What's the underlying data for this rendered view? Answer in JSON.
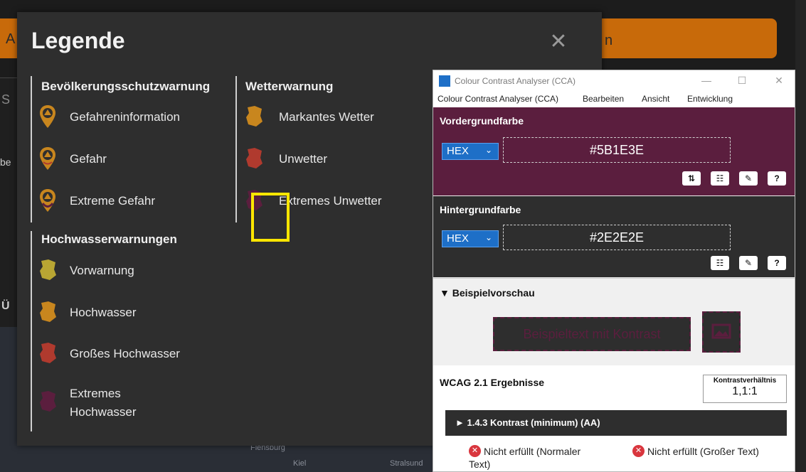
{
  "background_app": {
    "button_right_fragment": "n",
    "button_left_fragment": "A",
    "fragment_s": "S",
    "fragment_be": "be",
    "fragment_u": "Ü",
    "map_cities": [
      "Flensburg",
      "Kiel",
      "Stralsund"
    ]
  },
  "legend": {
    "title": "Legende",
    "close_icon": "close-icon",
    "columns": [
      {
        "groups": [
          {
            "heading": "Bevölkerungsschutzwarnung",
            "items": [
              {
                "label": "Gefahreninformation",
                "icon": "pin-info-icon",
                "color": "#c8861e"
              },
              {
                "label": "Gefahr",
                "icon": "pin-danger-icon",
                "color": "#c8861e"
              },
              {
                "label": "Extreme Gefahr",
                "icon": "pin-extreme-icon",
                "color": "#c8861e"
              }
            ]
          },
          {
            "heading": "Hochwasserwarnungen",
            "items": [
              {
                "label": "Vorwarnung",
                "icon": "region-shape-icon",
                "color": "#b9a633"
              },
              {
                "label": "Hochwasser",
                "icon": "region-shape-icon",
                "color": "#c8861e"
              },
              {
                "label": "Großes Hochwasser",
                "icon": "region-shape-icon",
                "color": "#b03a2e"
              },
              {
                "label": "Extremes",
                "label2": "Hochwasser",
                "icon": "region-shape-icon",
                "color": "#5b1e3e"
              }
            ]
          }
        ]
      },
      {
        "groups": [
          {
            "heading": "Wetterwarnung",
            "items": [
              {
                "label": "Markantes Wetter",
                "icon": "region-shape-icon",
                "color": "#c8861e"
              },
              {
                "label": "Unwetter",
                "icon": "region-shape-icon",
                "color": "#b03a2e"
              },
              {
                "label": "Extremes Unwetter",
                "icon": "region-shape-icon",
                "color": "#5b1e3e"
              }
            ]
          }
        ]
      }
    ],
    "highlight_color": "#ffe600"
  },
  "cca": {
    "window_title": "Colour Contrast Analyser (CCA)",
    "menu": [
      "Colour Contrast Analyser (CCA)",
      "Bearbeiten",
      "Ansicht",
      "Entwicklung"
    ],
    "foreground": {
      "title": "Vordergrundfarbe",
      "format": "HEX",
      "value": "#5B1E3E",
      "color": "#5b1e3e",
      "tools": [
        "swap-icon",
        "sliders-icon",
        "eyedropper-icon",
        "help-icon"
      ]
    },
    "background": {
      "title": "Hintergrundfarbe",
      "format": "HEX",
      "value": "#2E2E2E",
      "color": "#2e2e2e",
      "tools": [
        "sliders-icon",
        "eyedropper-icon",
        "help-icon"
      ]
    },
    "preview": {
      "heading": "▼ Beispielvorschau",
      "sample_text": "Beispieltext mit Kontrast"
    },
    "wcag": {
      "heading": "WCAG 2.1 Ergebnisse",
      "ratio_label": "Kontrastverhältnis",
      "ratio_value": "1,1:1",
      "criterion": "► 1.4.3 Kontrast (minimum) (AA)",
      "result_normal": "Nicht erfüllt (Normaler",
      "result_normal2": "Text)",
      "result_large": "Nicht erfüllt (Großer Text)",
      "fail_color": "#d9363e"
    }
  }
}
